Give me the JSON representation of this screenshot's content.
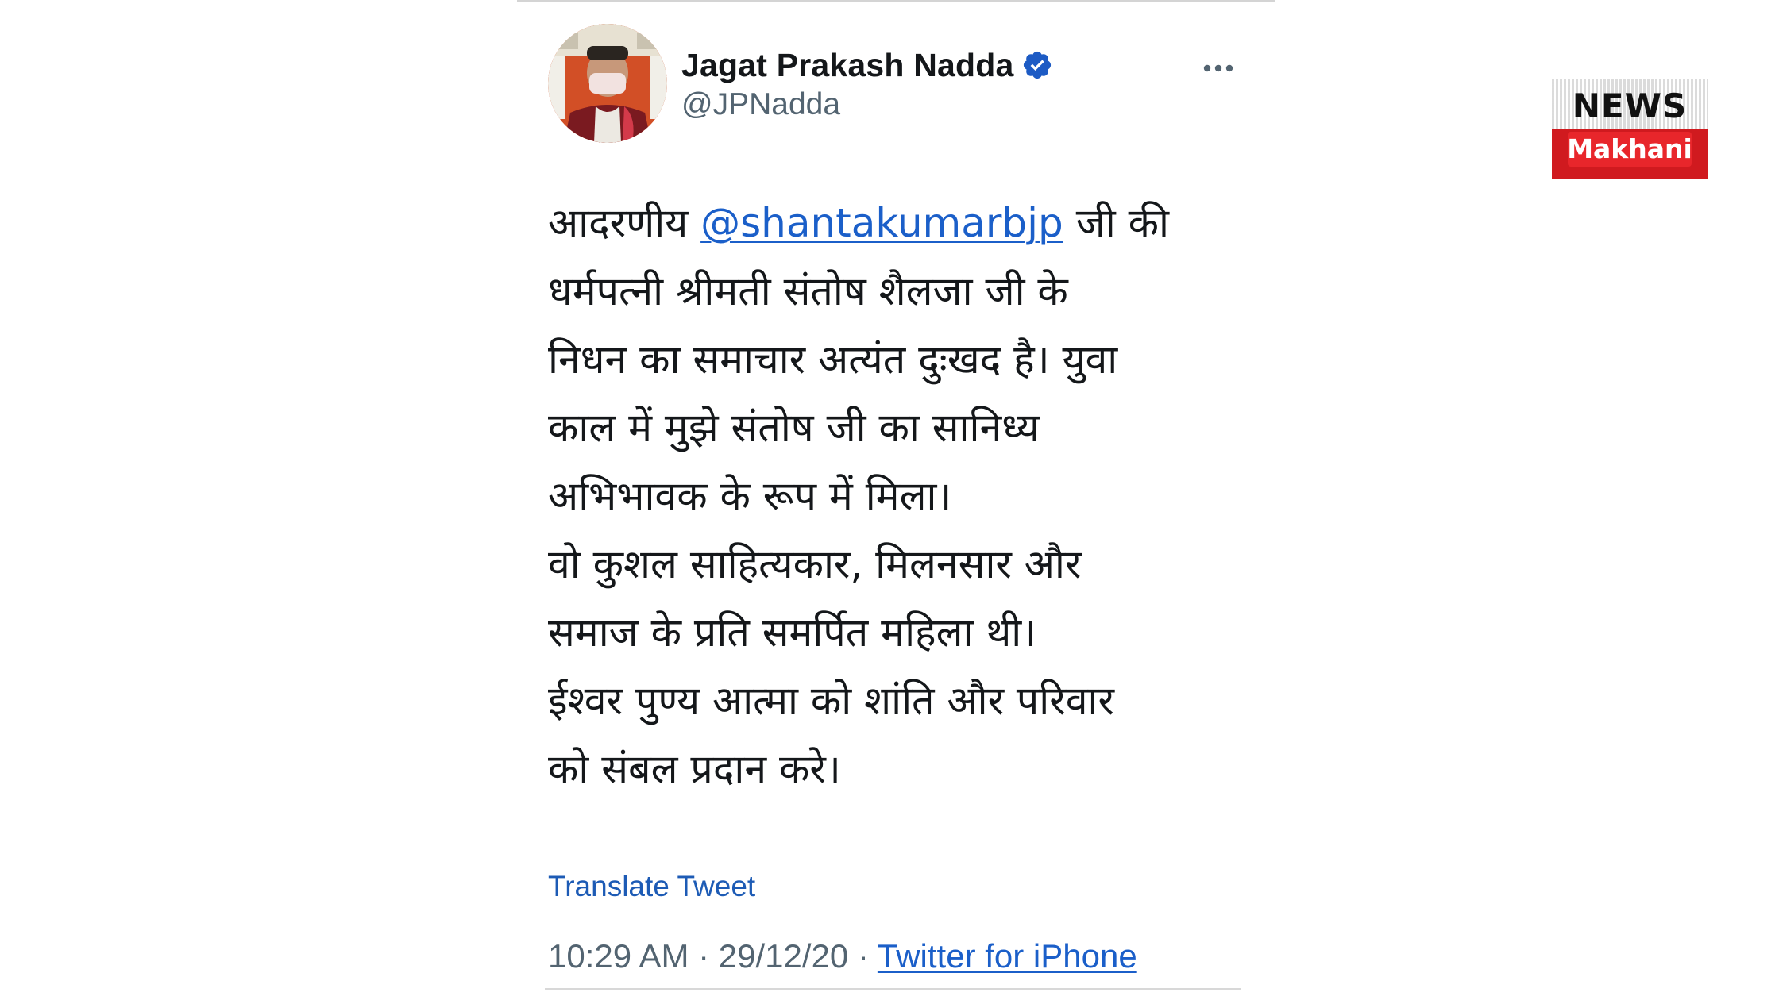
{
  "tweet": {
    "author": {
      "display_name": "Jagat Prakash Nadda",
      "handle": "@JPNadda",
      "verified": true
    },
    "text": {
      "line1_before": "आदरणीय ",
      "line1_mention": "@shantakumarbjp",
      "line1_after": " जी की",
      "line2": "धर्मपत्नी श्रीमती संतोष शैलजा जी के",
      "line3": "निधन का समाचार अत्यंत दुःखद है। युवा",
      "line4": "काल में मुझे संतोष जी का सानिध्य",
      "line5": "अभिभावक के रूप में मिला।",
      "line6": "वो कुशल साहित्यकार, मिलनसार और",
      "line7": "समाज के प्रति समर्पित महिला थी।",
      "line8": "ईश्वर पुण्य आत्मा को शांति और परिवार",
      "line9": "को संबल प्रदान करे।"
    },
    "translate_label": "Translate Tweet",
    "meta": {
      "time": "10:29 AM",
      "separator": " · ",
      "date": "29/12/20",
      "source": "Twitter for iPhone"
    }
  },
  "icons": {
    "verified": "verified-badge-icon",
    "more": "more-dots-icon"
  },
  "colors": {
    "link_blue": "#1b5fc9",
    "verified_blue": "#1d5bc4",
    "text_dark": "#14171a",
    "text_muted": "#536471",
    "brand_red": "#d01a1f"
  },
  "watermark": {
    "top_word": "NEWS",
    "bottom_word": "Makhani"
  }
}
